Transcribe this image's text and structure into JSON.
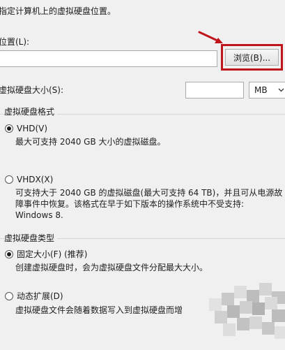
{
  "header": {
    "instruction": "指定计算机上的虚拟硬盘位置。"
  },
  "location": {
    "label": "位置(L):",
    "value": "",
    "browse_label": "浏览(B)..."
  },
  "size": {
    "label": "虚拟硬盘大小(S):",
    "value": "",
    "unit": "MB"
  },
  "format_group": {
    "title": "虚拟硬盘格式",
    "options": [
      {
        "label": "VHD(V)",
        "selected": true,
        "description": [
          "最大可支持 2040 GB 大小的虚拟磁盘。"
        ]
      },
      {
        "label": "VHDX(X)",
        "selected": false,
        "description": [
          "可支持大于 2040 GB 的虚拟磁盘(最大可支持 64 TB)，并且可从电源故",
          "障事件中恢复。该格式在早于如下版本的操作系统中不受支持:",
          "Windows 8."
        ]
      }
    ]
  },
  "type_group": {
    "title": "虚拟硬盘类型",
    "options": [
      {
        "label": "固定大小(F) (推荐)",
        "selected": true,
        "description": [
          "创建虚拟硬盘时，会为虚拟硬盘文件分配最大大小。"
        ]
      },
      {
        "label": "动态扩展(D)",
        "selected": false,
        "description": [
          "虚拟硬盘文件会随着数据写入到虚拟硬盘而增"
        ]
      }
    ]
  },
  "colors": {
    "highlight": "#c0141b",
    "arrow": "#c0141b"
  }
}
